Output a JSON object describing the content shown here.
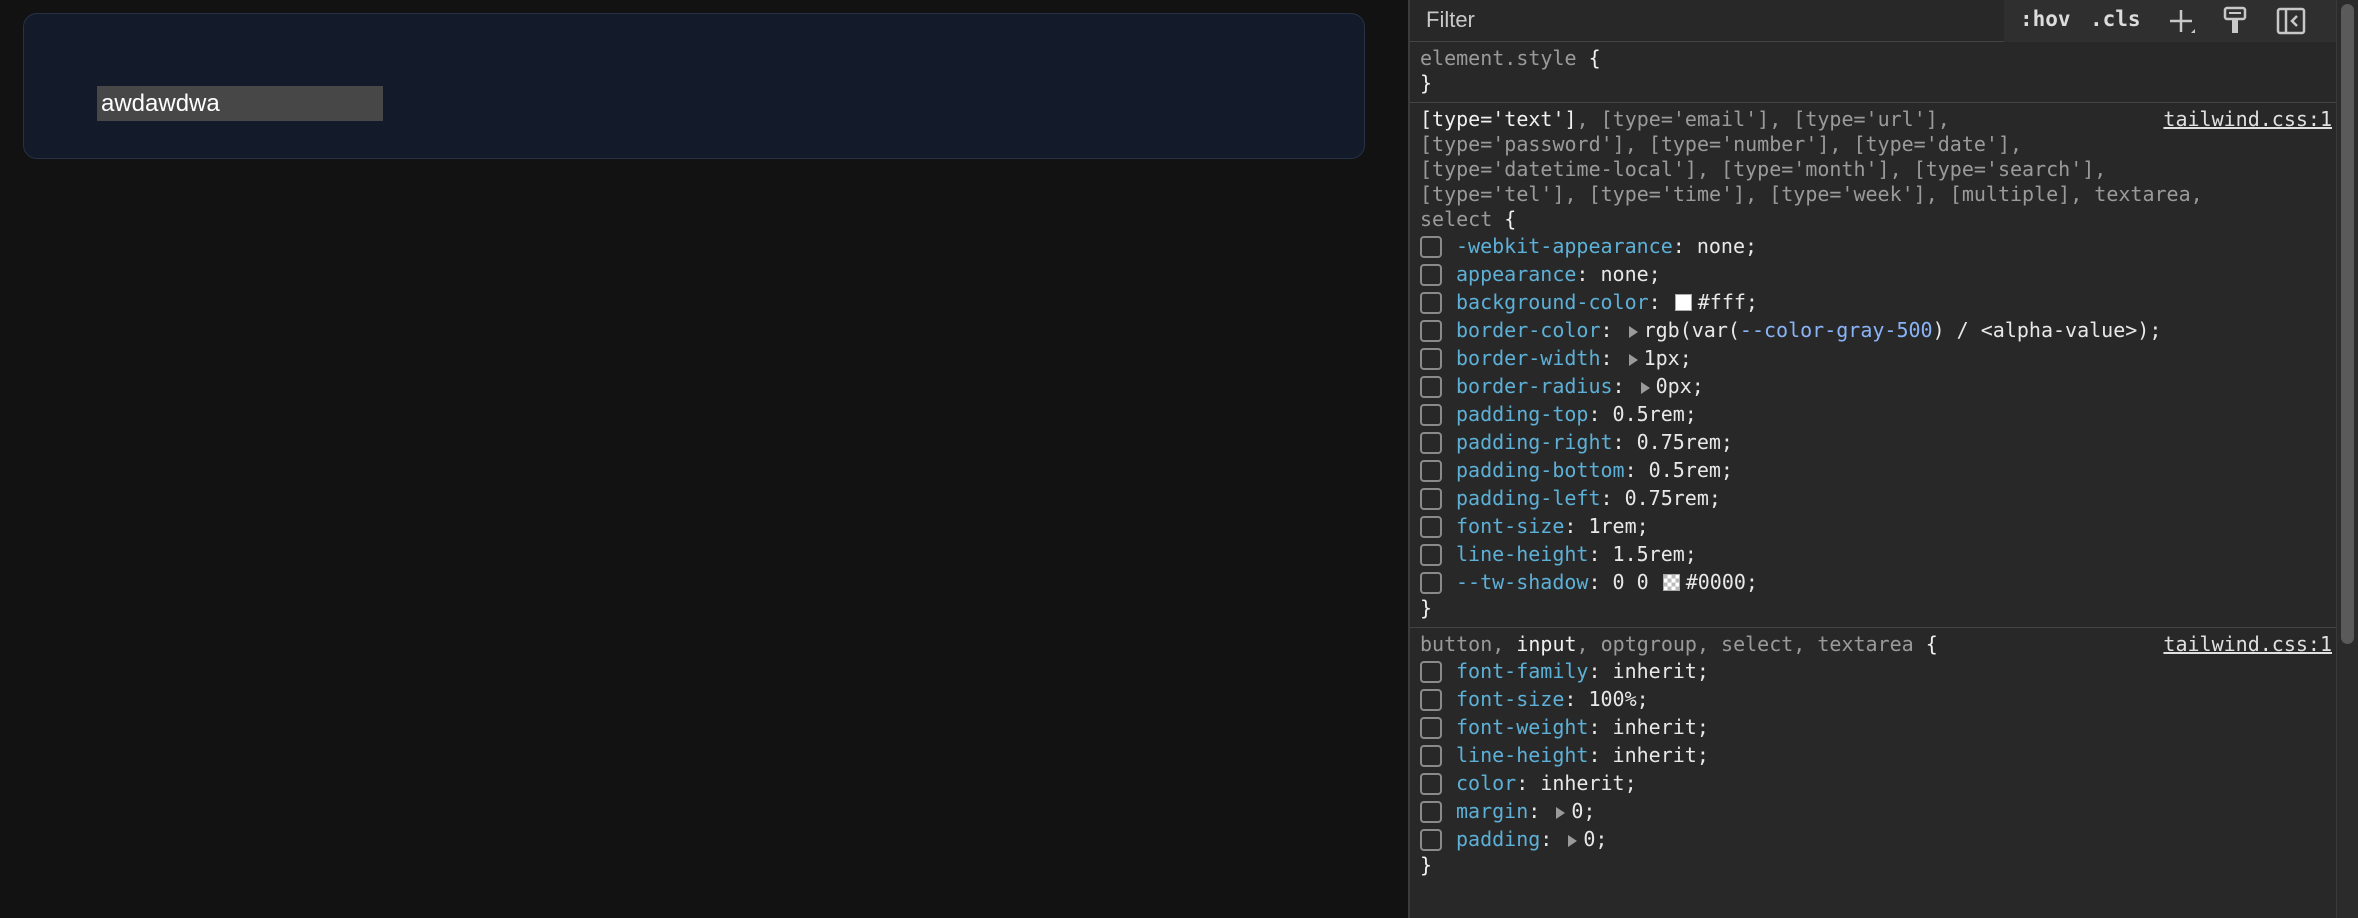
{
  "page": {
    "input_value": "awdawdwa"
  },
  "devtools": {
    "filter_placeholder": "Filter",
    "hov_label": ":hov",
    "cls_label": ".cls",
    "icons": [
      "plus-icon",
      "paint-brush-icon",
      "sidebar-toggle-icon"
    ],
    "element_style": {
      "selector": "element.style",
      "open": "{",
      "close": "}"
    },
    "rule1": {
      "source": "tailwind.css:1",
      "selector_match": "[type='text']",
      "selector_line1_rest": ", [type='email'], [type='url'],",
      "selector_line2": "[type='password'], [type='number'], [type='date'],",
      "selector_line3": "[type='datetime-local'], [type='month'], [type='search'],",
      "selector_line4": "[type='tel'], [type='time'], [type='week'], [multiple], textarea,",
      "selector_line5": "select",
      "open": "{",
      "close": "}",
      "props": [
        {
          "name": "-webkit-appearance",
          "value": "none;"
        },
        {
          "name": "appearance",
          "value": "none;"
        },
        {
          "name": "background-color",
          "value": "#fff;",
          "swatch": "#ffffff"
        },
        {
          "name": "border-color",
          "value_prefix": "rgb(var(",
          "value_var": "--color-gray-500",
          "value_suffix": ") / <alpha-value>);"
        },
        {
          "name": "border-width",
          "value": "1px;"
        },
        {
          "name": "border-radius",
          "value": "0px;"
        },
        {
          "name": "padding-top",
          "value": "0.5rem;"
        },
        {
          "name": "padding-right",
          "value": "0.75rem;"
        },
        {
          "name": "padding-bottom",
          "value": "0.5rem;"
        },
        {
          "name": "padding-left",
          "value": "0.75rem;"
        },
        {
          "name": "font-size",
          "value": "1rem;"
        },
        {
          "name": "line-height",
          "value": "1.5rem;"
        },
        {
          "name": "--tw-shadow",
          "value_prefix": "0 0 ",
          "value": "#0000;",
          "swatch": "#00000000"
        }
      ]
    },
    "rule2": {
      "source": "tailwind.css:1",
      "selector_a": "button, ",
      "selector_match": "input",
      "selector_b": ", optgroup, select, textarea",
      "open": "{",
      "close": "}",
      "props": [
        {
          "name": "font-family",
          "value": "inherit;"
        },
        {
          "name": "font-size",
          "value": "100%;"
        },
        {
          "name": "font-weight",
          "value": "inherit;"
        },
        {
          "name": "line-height",
          "value": "inherit;"
        },
        {
          "name": "color",
          "value": "inherit;"
        },
        {
          "name": "margin",
          "value": "0;"
        },
        {
          "name": "padding",
          "value": "0;"
        }
      ]
    }
  }
}
